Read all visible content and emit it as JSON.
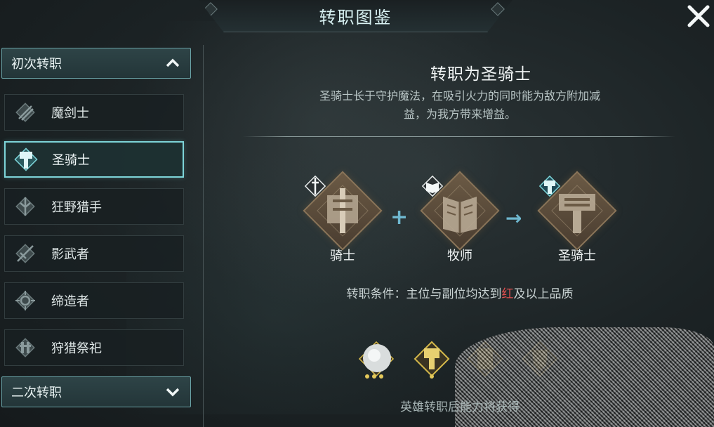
{
  "window": {
    "title": "转职图鉴",
    "close_label": "✕"
  },
  "sidebar": {
    "first_category": {
      "label": "初次转职",
      "chevron": "chevron-up-icon",
      "expanded": true
    },
    "items": [
      {
        "label": "魔剑士",
        "icon": "magic-sword-icon",
        "selected": false
      },
      {
        "label": "圣骑士",
        "icon": "hammer-icon",
        "selected": true
      },
      {
        "label": "狂野猎手",
        "icon": "wild-hunter-icon",
        "selected": false
      },
      {
        "label": "影武者",
        "icon": "shadow-warrior-icon",
        "selected": false
      },
      {
        "label": "缔造者",
        "icon": "creator-icon",
        "selected": false
      },
      {
        "label": "狩猎祭祀",
        "icon": "hunt-priest-icon",
        "selected": false
      }
    ],
    "second_category": {
      "label": "二次转职",
      "chevron": "chevron-down-icon",
      "expanded": false
    }
  },
  "main": {
    "title": "转职为圣骑士",
    "description_line1": "圣骑士长于守护魔法，在吸引火力的同时能为敌方附加减",
    "description_line2": "益，为我方带来增益。",
    "formula": {
      "first": {
        "label": "骑士",
        "icon": "knight-icon"
      },
      "plus": "+",
      "second": {
        "label": "牧师",
        "icon": "priest-icon"
      },
      "arrow": "→",
      "result": {
        "label": "圣骑士",
        "icon": "hammer-icon"
      }
    },
    "condition_prefix": "转职条件：主位与副位均达到",
    "condition_highlight": "红",
    "condition_suffix": "及以上品质",
    "footer_note": "英雄转职后能力将获得",
    "rewards": [
      "orb-icon",
      "hammer-badge-icon",
      "armor-badge-icon",
      "shield-badge-icon"
    ]
  },
  "colors": {
    "accent": "#7dd4d8",
    "highlight_red": "#e35050",
    "gold": "#d4b84a",
    "bronze": "#6b5a45"
  }
}
